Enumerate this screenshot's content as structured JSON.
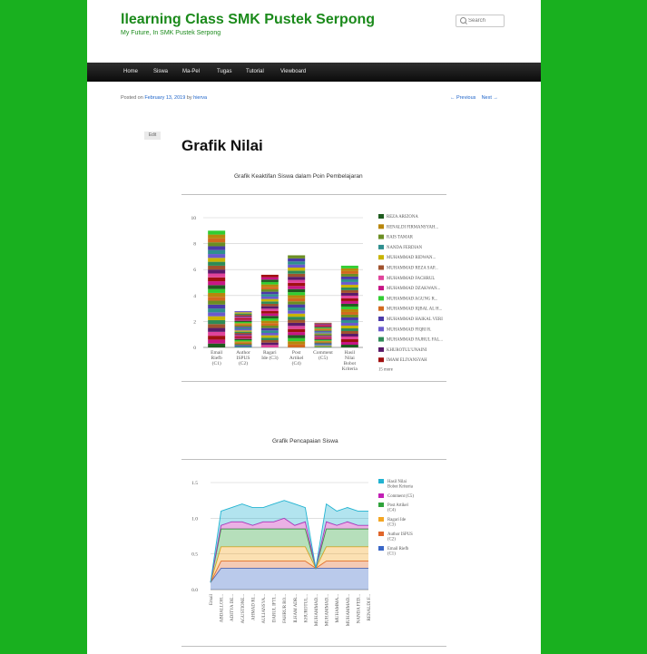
{
  "site": {
    "title": "llearning Class SMK Pustek Serpong",
    "tagline": "My Future, In SMK Pustek Serpong"
  },
  "search": {
    "placeholder": "Search"
  },
  "nav": {
    "items": [
      "Home",
      "Siswa",
      "Ma-Pel",
      "Tugas",
      "Tutorial",
      "Viewboard"
    ]
  },
  "post": {
    "posted_on": "Posted on",
    "date": "February 13, 2019",
    "by": "by",
    "author": "hierva",
    "prev": "← Previous",
    "next": "Next →",
    "edit": "Edit",
    "title": "Grafik Nilai"
  },
  "colors": {
    "brand_green": "#1b8a1b",
    "background": "#19b01f",
    "link": "#1b62c8"
  },
  "chart_data": [
    {
      "type": "bar",
      "title": "Grafik Keaktifan Siswa dalam Poin Pembelajaran",
      "stacked": true,
      "categories": [
        "Email Riefb (C1)",
        "Author ISPUS (C2)",
        "Ragari Ide (C3)",
        "Post Artikel (C4)",
        "Comment (C5)",
        "Hasil Nilai Bobot Kriteria"
      ],
      "totals": [
        9.0,
        2.8,
        5.6,
        7.1,
        1.9,
        6.3
      ],
      "ylim": [
        0,
        10
      ],
      "yticks": [
        "0",
        "2",
        "4",
        "6",
        "8",
        "10"
      ],
      "legend_position": "right",
      "legend": [
        "REZA ARIZONA",
        "RENALDI FIRMANSYAH...",
        "RAIS TAMAR",
        "NANDA FERDIAN",
        "MUHAMMAD RIDWAN...",
        "MUHAMMAD REZA SAP...",
        "MUHAMMAD FACHRUL",
        "MUHAMMAD DZAKWAN...",
        "MUHAMMAD AGUNG R...",
        "MUHAMMAD IQBAL AL H...",
        "MUHAMMAD HAIKAL VERI",
        "MUHAMMAD FIQRI R.",
        "MUHAMMAD FAJRUL FAL...",
        "KHUROTUL'UNAINI",
        "IMAM ELIYANSYAH"
      ],
      "legend_colors": [
        "#1f5c1f",
        "#b8860b",
        "#6b8e23",
        "#2f8f8f",
        "#c8b400",
        "#a0522d",
        "#e0449b",
        "#c71585",
        "#32cd32",
        "#d2691e",
        "#4b3aa8",
        "#6a5acd",
        "#2e8b57",
        "#5a1a6a",
        "#a01010"
      ],
      "more_label": "15 more"
    },
    {
      "type": "area",
      "title": "Grafik Pencapaian Siswa",
      "stacked": true,
      "ylim": [
        0,
        1.5
      ],
      "yticks": [
        "0.0",
        "0.5",
        "1.0",
        "1.5"
      ],
      "legend_position": "right",
      "x": [
        "Email",
        "ABDALLOH...",
        "ADITYA DE...",
        "AGUSTIONE...",
        "AHMAD RI...",
        "AULIANSYA...",
        "DARUL IFTI...",
        "FAHRUR RO...",
        "ILHAM ADR...",
        "KHUROTUL...",
        "MUHAMMAD...",
        "MUHAMMAD...",
        "MUHAMMA...",
        "MUHAMMAD...",
        "NANDA FED...",
        "RENALDI F..."
      ],
      "series": [
        {
          "name": "Email Riefb (C1)",
          "color": "#3a67c7",
          "values": [
            0.1,
            0.3,
            0.3,
            0.3,
            0.3,
            0.3,
            0.3,
            0.3,
            0.3,
            0.3,
            0.3,
            0.3,
            0.3,
            0.3,
            0.3,
            0.3
          ]
        },
        {
          "name": "Author ISPUS (C2)",
          "color": "#e0662b",
          "values": [
            0.0,
            0.1,
            0.1,
            0.1,
            0.1,
            0.1,
            0.1,
            0.1,
            0.1,
            0.1,
            0.0,
            0.1,
            0.1,
            0.1,
            0.1,
            0.1
          ]
        },
        {
          "name": "Ragari Ide (C3)",
          "color": "#f4a623",
          "values": [
            0.0,
            0.2,
            0.2,
            0.2,
            0.2,
            0.2,
            0.2,
            0.2,
            0.2,
            0.2,
            0.0,
            0.2,
            0.2,
            0.2,
            0.2,
            0.2
          ]
        },
        {
          "name": "Post Artikel (C4)",
          "color": "#2fa33b",
          "values": [
            0.0,
            0.25,
            0.25,
            0.25,
            0.25,
            0.25,
            0.25,
            0.25,
            0.25,
            0.25,
            0.0,
            0.25,
            0.25,
            0.25,
            0.25,
            0.25
          ]
        },
        {
          "name": "Comment (C5)",
          "color": "#c21fb5",
          "values": [
            0.0,
            0.05,
            0.1,
            0.1,
            0.05,
            0.1,
            0.1,
            0.15,
            0.05,
            0.1,
            0.0,
            0.1,
            0.05,
            0.1,
            0.05,
            0.05
          ]
        },
        {
          "name": "Hasil Nilai Bobot Kriteria",
          "color": "#22b3d1",
          "values": [
            0.0,
            0.2,
            0.2,
            0.25,
            0.25,
            0.2,
            0.25,
            0.25,
            0.3,
            0.2,
            0.0,
            0.25,
            0.2,
            0.2,
            0.2,
            0.2
          ]
        }
      ]
    }
  ]
}
